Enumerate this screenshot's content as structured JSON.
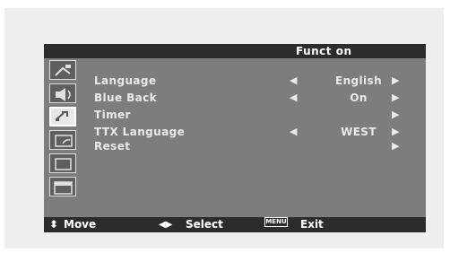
{
  "osd": {
    "title": "Funct on",
    "sidebar_icons": [
      "picture-icon",
      "sound-icon",
      "function-icon",
      "channel-icon",
      "screen-icon",
      "pip-icon"
    ],
    "rows": [
      {
        "label": "Language",
        "left_arrow": "◀",
        "value": "English",
        "right_arrow": "▶"
      },
      {
        "label": "Blue Back",
        "left_arrow": "◀",
        "value": "On",
        "right_arrow": "▶"
      },
      {
        "label": "Timer",
        "left_arrow": "",
        "value": "",
        "right_arrow": "▶"
      },
      {
        "label": "TTX Language",
        "left_arrow": "◀",
        "value": "WEST",
        "right_arrow": "▶"
      },
      {
        "label": "Reset",
        "left_arrow": "",
        "value": "",
        "right_arrow": "▶"
      }
    ],
    "footer": {
      "move_icon": "⬍",
      "move_label": "Move",
      "select_icon": "◀▶",
      "select_label": "Select",
      "menu_badge": "MENU",
      "exit_label": "Exit"
    }
  }
}
